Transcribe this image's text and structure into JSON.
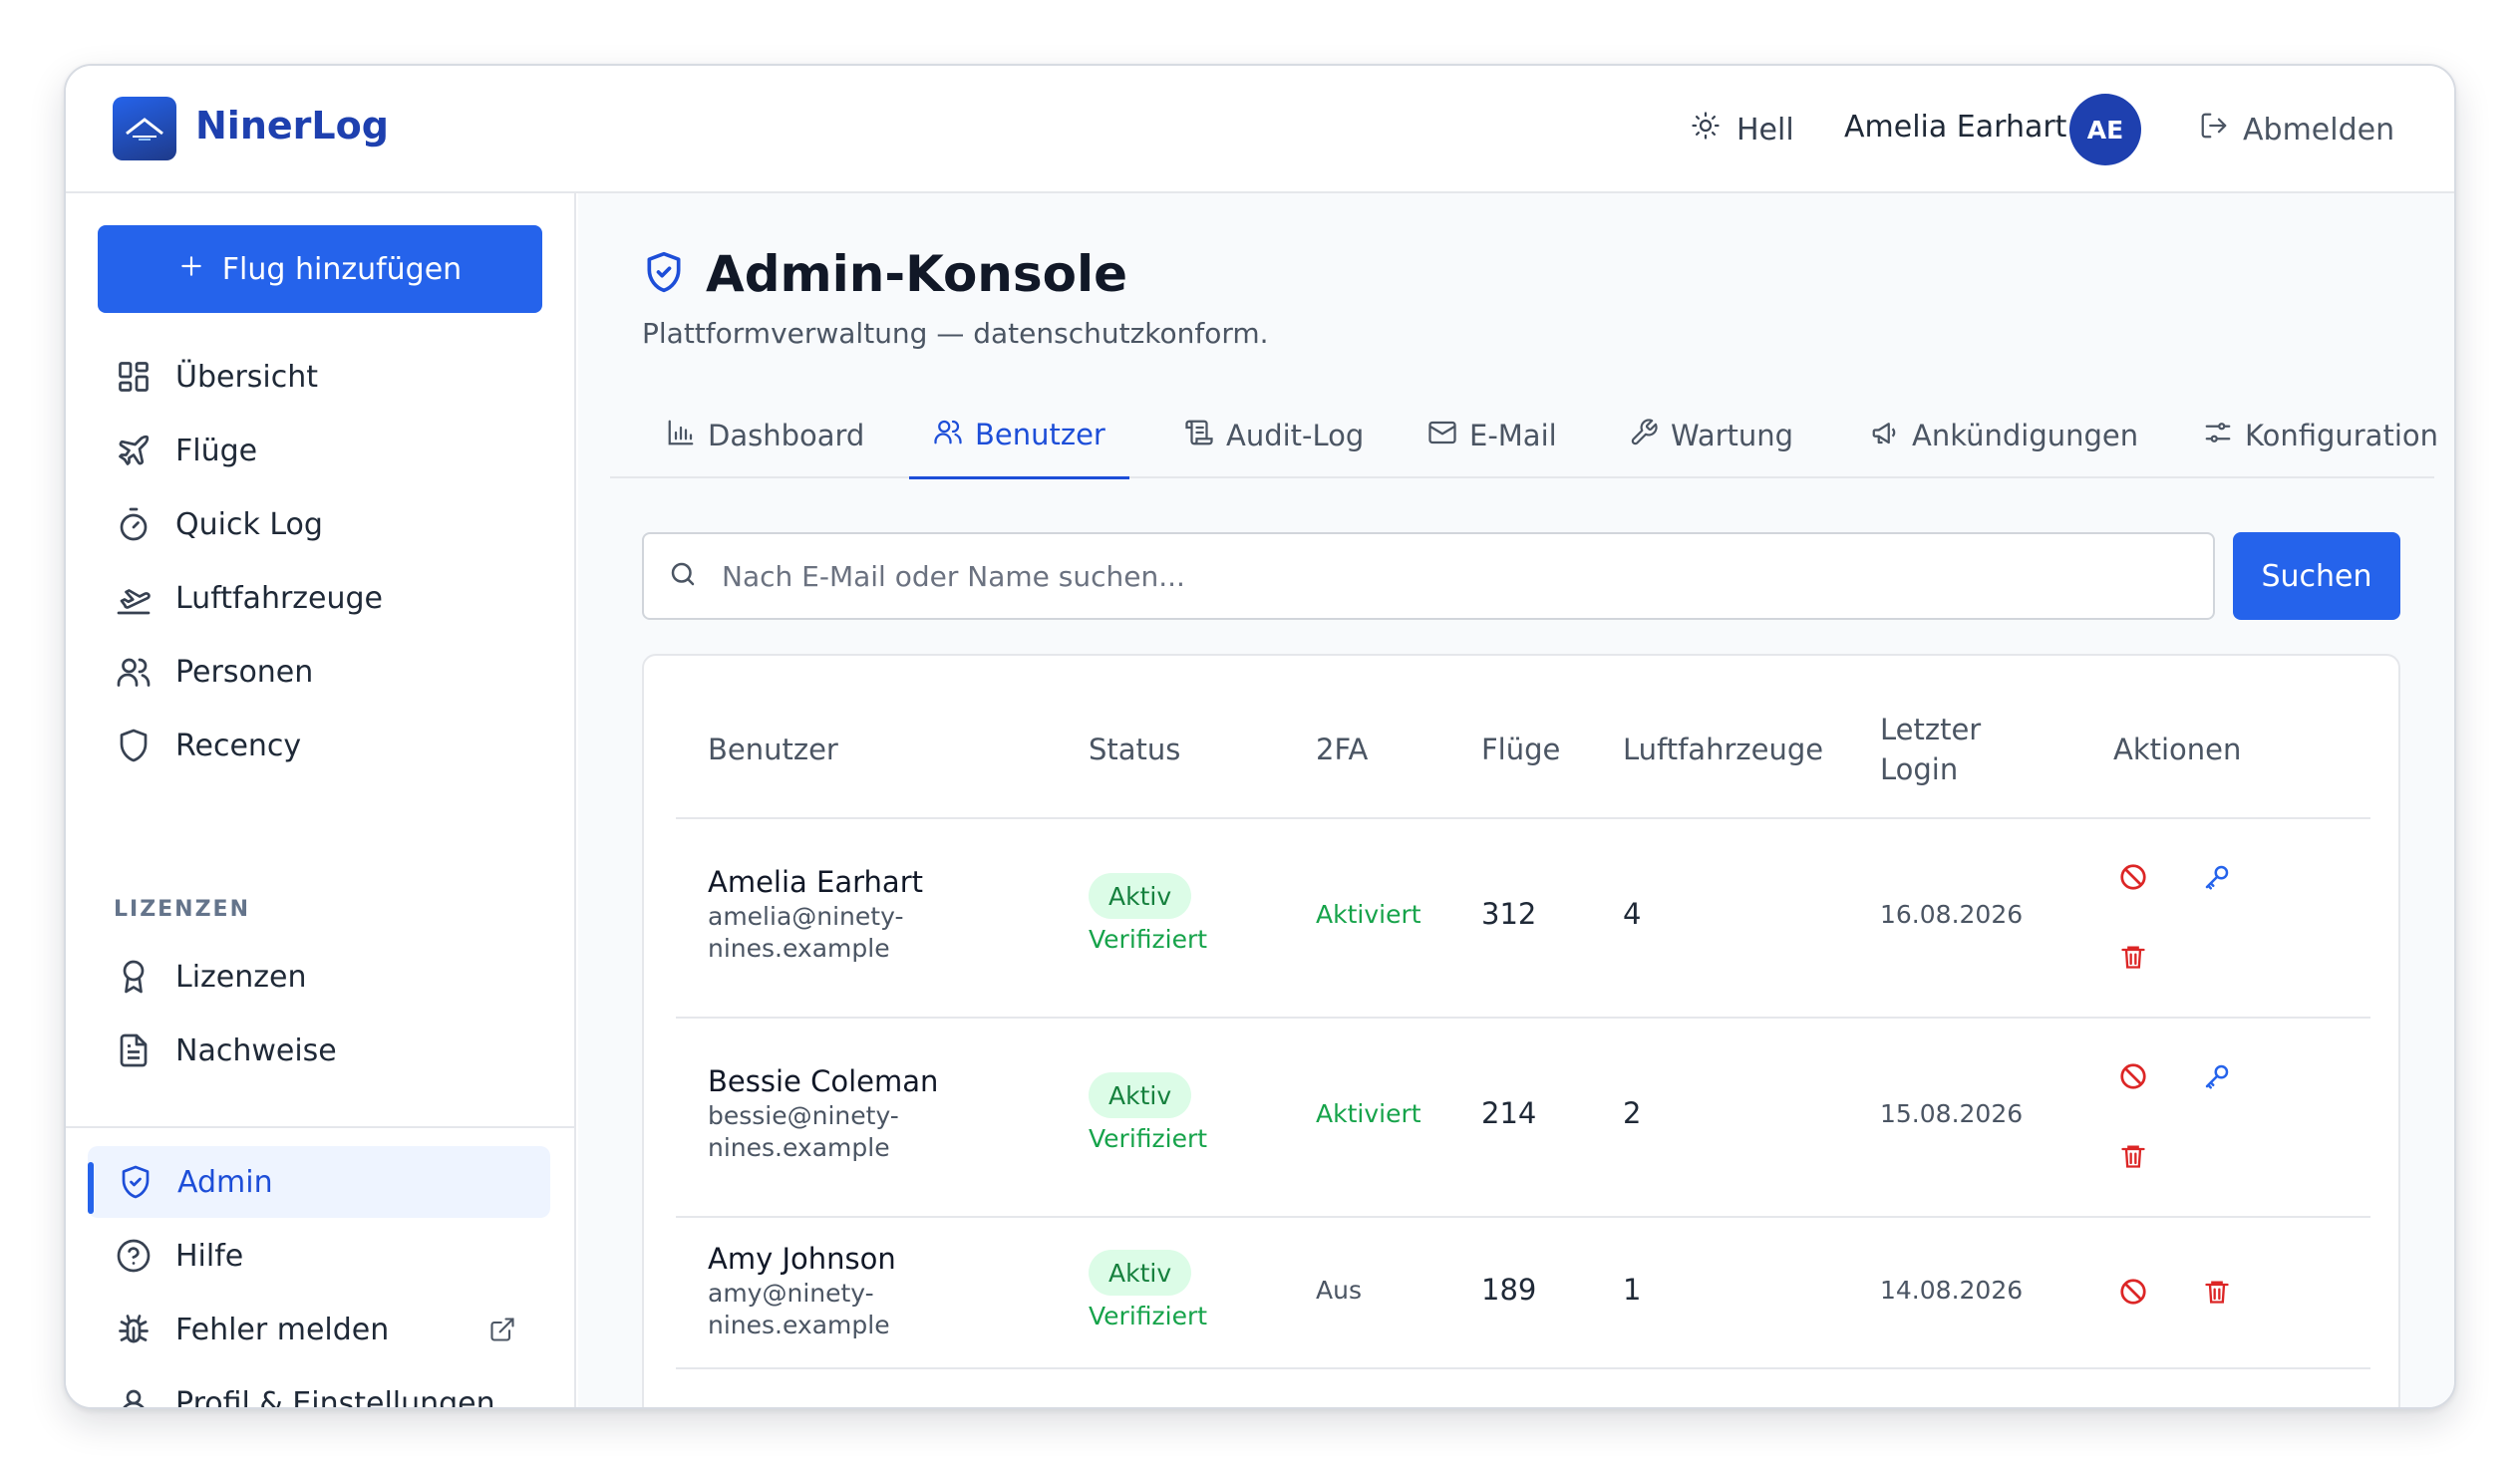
{
  "app": {
    "brand": "NinerLog"
  },
  "header": {
    "theme_label": "Hell",
    "user_name": "Amelia Earhart",
    "avatar_initials": "AE",
    "logout_label": "Abmelden"
  },
  "sidebar": {
    "add_flight_label": "Flug hinzufügen",
    "items": [
      {
        "label": "Übersicht",
        "icon": "grid-icon"
      },
      {
        "label": "Flüge",
        "icon": "plane-icon"
      },
      {
        "label": "Quick Log",
        "icon": "stopwatch-icon"
      },
      {
        "label": "Luftfahrzeuge",
        "icon": "plane-takeoff-icon"
      },
      {
        "label": "Personen",
        "icon": "users-icon"
      },
      {
        "label": "Recency",
        "icon": "shield-icon"
      }
    ],
    "section_label": "LIZENZEN",
    "license_items": [
      {
        "label": "Lizenzen",
        "icon": "award-icon"
      },
      {
        "label": "Nachweise",
        "icon": "document-icon"
      }
    ],
    "bottom_items": [
      {
        "label": "Admin",
        "icon": "shield-check-icon",
        "active": true
      },
      {
        "label": "Hilfe",
        "icon": "help-circle-icon"
      },
      {
        "label": "Fehler melden",
        "icon": "bug-icon"
      },
      {
        "label": "Profil & Einstellungen",
        "icon": "user-icon"
      }
    ]
  },
  "main": {
    "title": "Admin-Konsole",
    "subtitle": "Plattformverwaltung — datenschutzkonform.",
    "tabs": [
      {
        "label": "Dashboard",
        "icon": "bar-chart-icon"
      },
      {
        "label": "Benutzer",
        "icon": "users-icon",
        "active": true
      },
      {
        "label": "Audit-Log",
        "icon": "scroll-icon"
      },
      {
        "label": "E-Mail",
        "icon": "mail-icon"
      },
      {
        "label": "Wartung",
        "icon": "wrench-icon"
      },
      {
        "label": "Ankündigungen",
        "icon": "megaphone-icon"
      },
      {
        "label": "Konfiguration",
        "icon": "sliders-icon"
      }
    ],
    "search": {
      "placeholder": "Nach E-Mail oder Name suchen...",
      "value": "",
      "button_label": "Suchen"
    },
    "table": {
      "columns": [
        "Benutzer",
        "Status",
        "2FA",
        "Flüge",
        "Luftfahrzeuge",
        "Letzter Login",
        "Aktionen"
      ],
      "rows": [
        {
          "name": "Amelia Earhart",
          "email": "amelia@ninety-nines.example",
          "status": "Aktiv",
          "verified": "Verifiziert",
          "tfa": "Aktiviert",
          "flights": "312",
          "aircraft": "4",
          "last_login": "16.08.2026",
          "actions": [
            "ban-icon",
            "key-icon",
            "trash-icon"
          ]
        },
        {
          "name": "Bessie Coleman",
          "email": "bessie@ninety-nines.example",
          "status": "Aktiv",
          "verified": "Verifiziert",
          "tfa": "Aktiviert",
          "flights": "214",
          "aircraft": "2",
          "last_login": "15.08.2026",
          "actions": [
            "ban-icon",
            "key-icon",
            "trash-icon"
          ]
        },
        {
          "name": "Amy Johnson",
          "email": "amy@ninety-nines.example",
          "status": "Aktiv",
          "verified": "Verifiziert",
          "tfa": "Aus",
          "flights": "189",
          "aircraft": "1",
          "last_login": "14.08.2026",
          "actions": [
            "ban-icon",
            "trash-icon"
          ]
        }
      ]
    }
  },
  "colors": {
    "primary": "#2563eb",
    "brand_text": "#1e40af",
    "success_bg": "#dcfce7",
    "success_text": "#15803d",
    "danger": "#dc2626"
  }
}
